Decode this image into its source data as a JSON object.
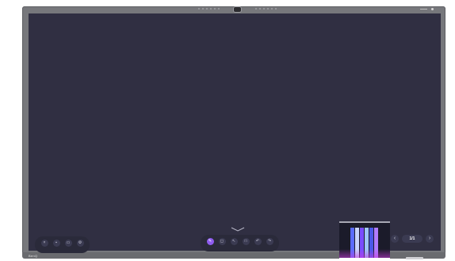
{
  "device": {
    "brand": "BenQ"
  },
  "left_toolbar": {
    "tools": [
      {
        "icon": "exit-icon",
        "label": ""
      },
      {
        "icon": "grid-icon",
        "label": ""
      },
      {
        "icon": "monitor-icon",
        "label": ""
      },
      {
        "icon": "settings-icon",
        "label": ""
      }
    ]
  },
  "center_toolbar": {
    "tools": [
      {
        "icon": "pen-icon",
        "label": "",
        "active": true
      },
      {
        "icon": "eraser-icon",
        "label": ""
      },
      {
        "icon": "select-icon",
        "label": ""
      },
      {
        "icon": "shapes-icon",
        "label": ""
      },
      {
        "icon": "undo-icon",
        "label": ""
      },
      {
        "icon": "redo-icon",
        "label": ""
      }
    ]
  },
  "pager": {
    "page": "1/1",
    "sub_label": "",
    "prev_icon": "chevron-left-icon",
    "next_icon": "chevron-right-icon"
  },
  "colors": {
    "canvas": "#302f42",
    "bezel": "#77787c",
    "accent": "#8f5cf0"
  }
}
